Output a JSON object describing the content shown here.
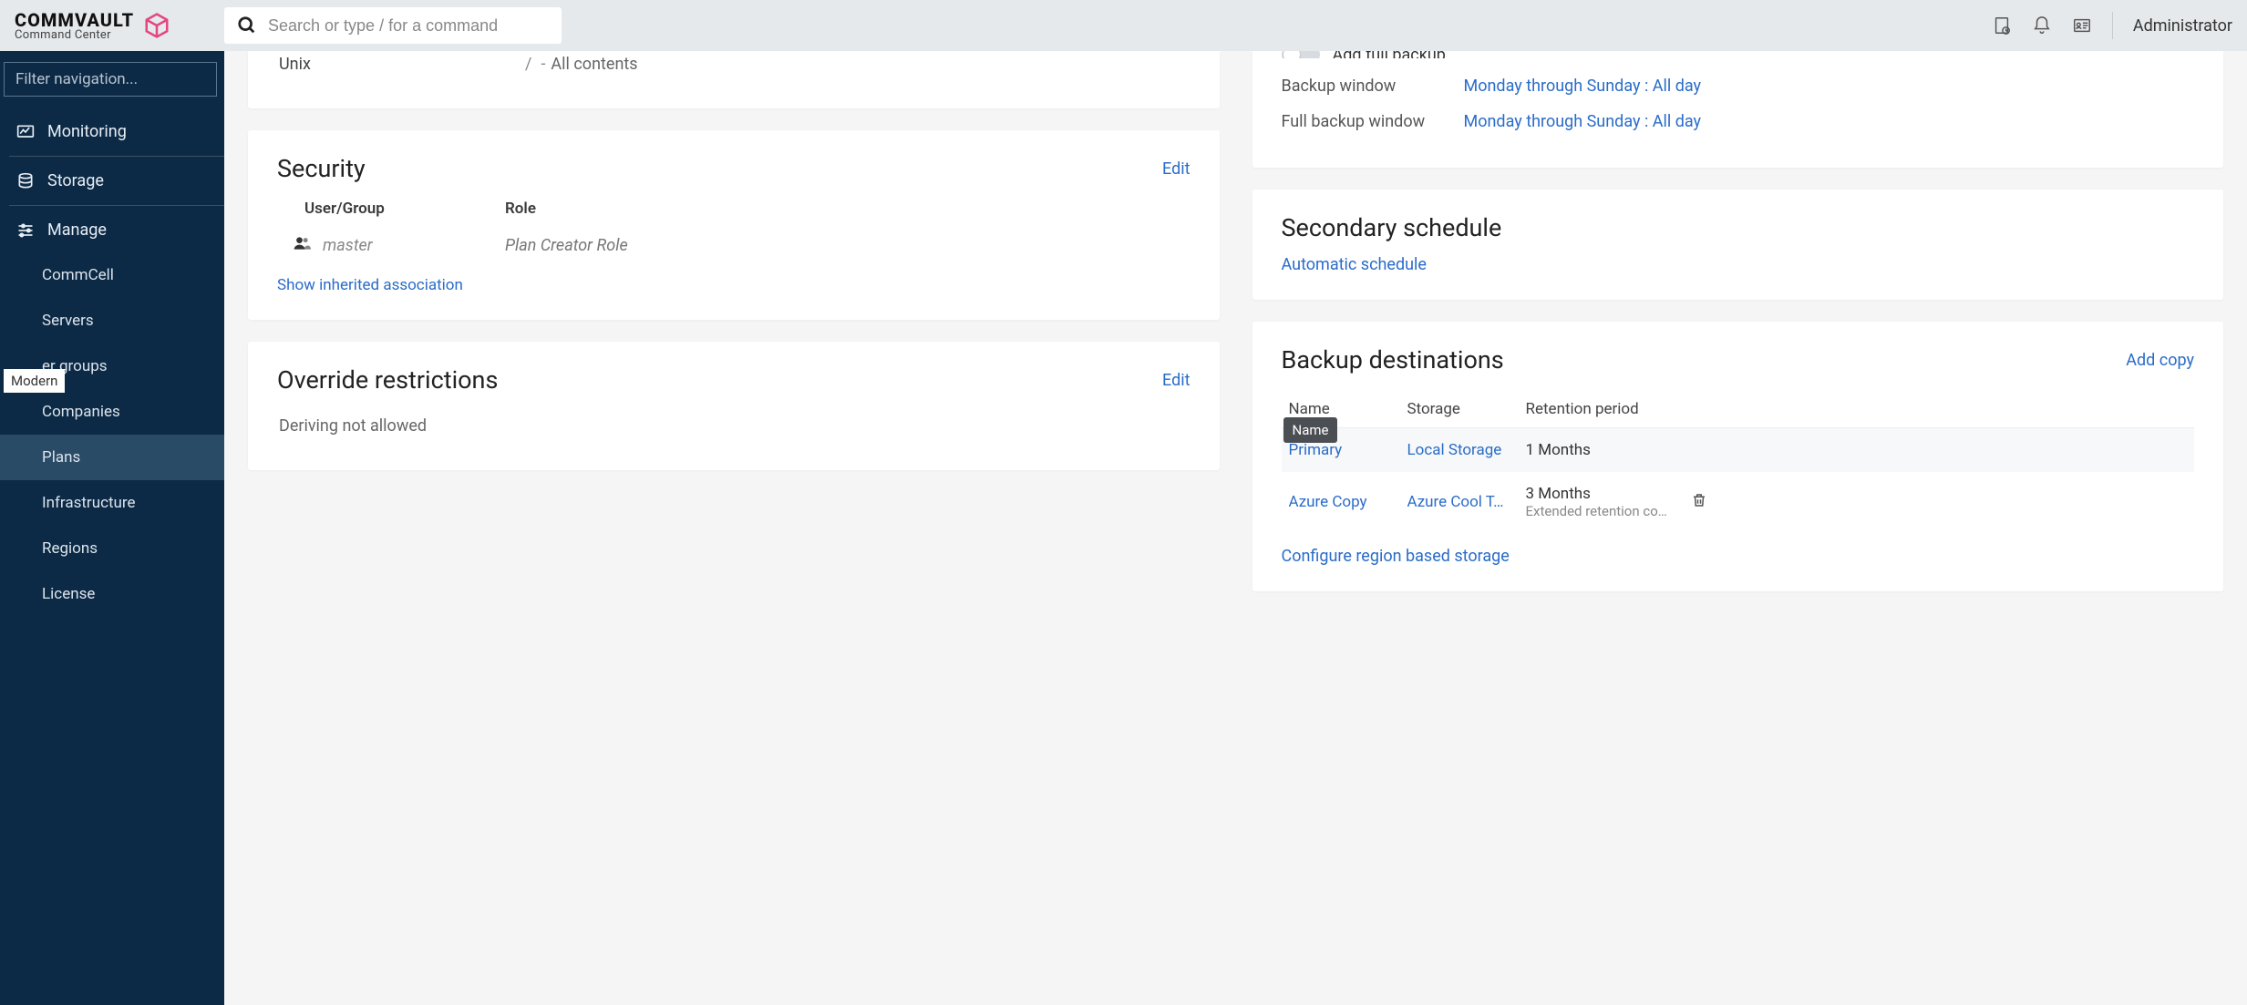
{
  "header": {
    "logo_main": "COMMVAULT",
    "logo_sub": "Command Center",
    "search_placeholder": "Search or type / for a command",
    "user_label": "Administrator"
  },
  "sidebar": {
    "filter_placeholder": "Filter navigation...",
    "items": {
      "monitoring": "Monitoring",
      "storage": "Storage",
      "manage": "Manage"
    },
    "manage_children": {
      "commcell": "CommCell",
      "servers": "Servers",
      "server_groups": "er groups",
      "companies": "Companies",
      "plans": "Plans",
      "infrastructure": "Infrastructure",
      "regions": "Regions",
      "license": "License"
    },
    "modern_badge": "Modern"
  },
  "left_col": {
    "unix": {
      "label": "Unix",
      "sep": "/",
      "dash": "-",
      "value": "All contents"
    },
    "security": {
      "title": "Security",
      "edit": "Edit",
      "col_user": "User/Group",
      "col_role": "Role",
      "user": "master",
      "role": "Plan Creator Role",
      "show_inherited": "Show inherited association"
    },
    "override": {
      "title": "Override restrictions",
      "edit": "Edit",
      "text": "Deriving not allowed"
    }
  },
  "right_col": {
    "rpo_tail": {
      "add_full": "Add full backup",
      "bw_key": "Backup window",
      "bw_val": "Monday through Sunday : All day",
      "fbw_key": "Full backup window",
      "fbw_val": "Monday through Sunday : All day"
    },
    "secondary": {
      "title": "Secondary schedule",
      "auto_link": "Automatic schedule"
    },
    "dest": {
      "title": "Backup destinations",
      "add_copy": "Add copy",
      "h_name": "Name",
      "h_storage": "Storage",
      "h_ret": "Retention period",
      "tooltip": "Name",
      "rows": [
        {
          "name": "Primary",
          "storage": "Local Storage",
          "ret": "1 Months",
          "sub": ""
        },
        {
          "name": "Azure Copy",
          "storage": "Azure Cool T…",
          "ret": "3 Months",
          "sub": "Extended retention co…"
        }
      ],
      "cfg": "Configure region based storage"
    }
  }
}
